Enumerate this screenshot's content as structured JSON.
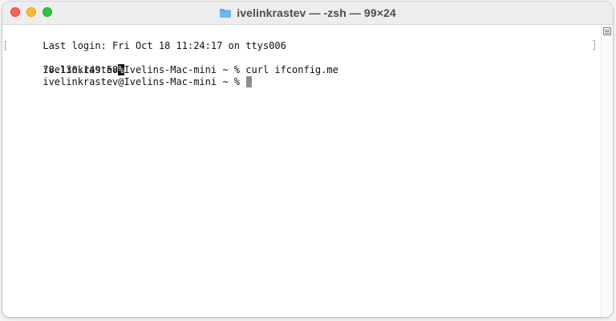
{
  "window": {
    "title": "ivelinkrastev — -zsh — 99×24"
  },
  "icons": {
    "folder": "folder-icon",
    "scroll": "scroll-marks-icon"
  },
  "colors": {
    "close": "#ff5f57",
    "minimize": "#febc2e",
    "zoom": "#28c840",
    "folder": "#5aa9e6"
  },
  "terminal": {
    "lines": [
      "Last login: Fri Oct 18 11:24:17 on ttys006",
      "ivelinkrastev@Ivelins-Mac-mini ~ % curl ifconfig.me",
      "78.130.149.58",
      "ivelinkrastev@Ivelins-Mac-mini ~ % "
    ],
    "no_newline_marker": "%"
  }
}
